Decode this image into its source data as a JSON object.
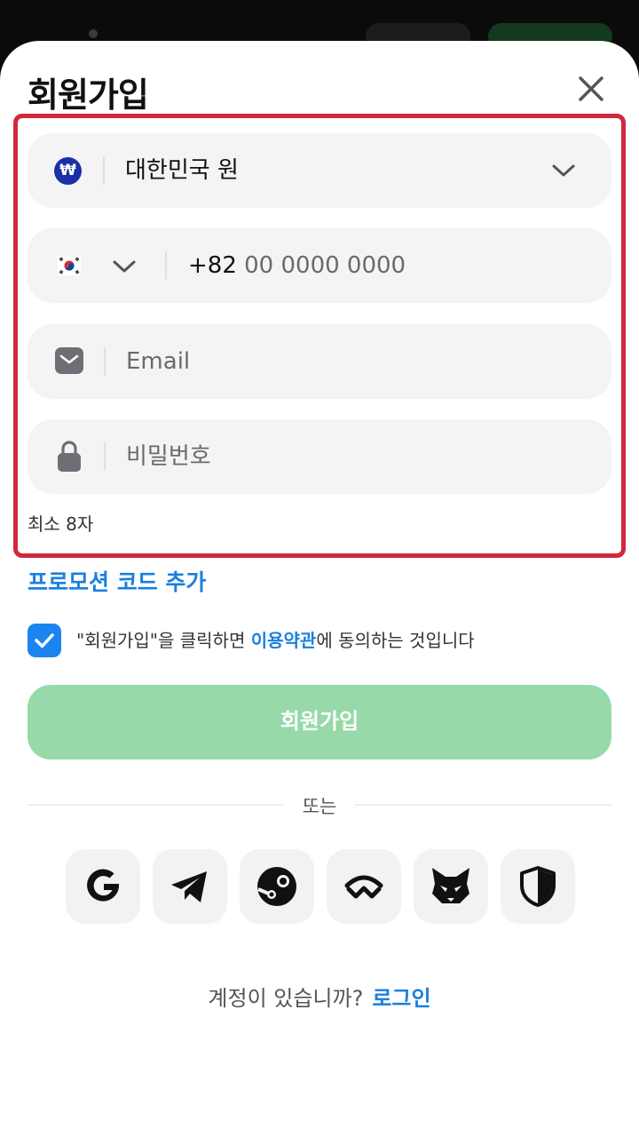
{
  "header": {
    "title": "회원가입"
  },
  "form": {
    "currency": {
      "symbol": "₩",
      "value": "대한민국 원"
    },
    "phone": {
      "prefix": "+82",
      "placeholder": "00 0000 0000"
    },
    "email": {
      "placeholder": "Email"
    },
    "password": {
      "placeholder": "비밀번호",
      "hint": "최소 8자"
    }
  },
  "promo_link": "프로모션 코드 추가",
  "terms": {
    "checked": true,
    "before": "\"회원가입\"을 클릭하면 ",
    "link": "이용약관",
    "after": "에 동의하는 것입니다"
  },
  "submit_label": "회원가입",
  "divider_label": "또는",
  "social_providers": [
    "google-icon",
    "telegram-icon",
    "steam-icon",
    "walletconnect-icon",
    "metamask-icon",
    "shield-icon"
  ],
  "footer": {
    "question": "계정이 있습니까?",
    "login_link": "로그인"
  },
  "colors": {
    "accent": "#1a7fe0",
    "submit_bg": "#97d9a8",
    "highlight_border": "#d0283e",
    "checkbox": "#1a85f0"
  }
}
